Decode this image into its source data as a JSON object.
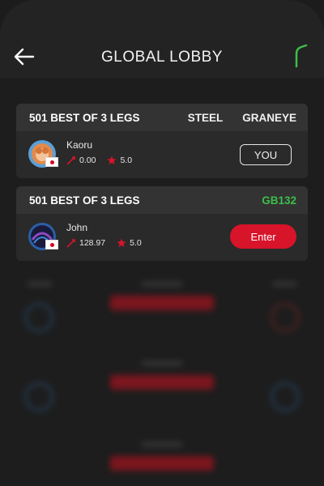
{
  "header": {
    "title": "GLOBAL LOBBY"
  },
  "cards": [
    {
      "title": "501 BEST OF 3 LEGS",
      "tags": [
        "STEEL",
        "GRANEYE"
      ],
      "player": {
        "name": "Kaoru",
        "rating": "0.00",
        "stars": "5.0"
      },
      "action_label": "YOU"
    },
    {
      "title": "501 BEST OF 3 LEGS",
      "code": "GB132",
      "player": {
        "name": "John",
        "rating": "128.97",
        "stars": "5.0"
      },
      "action_label": "Enter"
    }
  ],
  "colors": {
    "accent_green": "#3dbd4a",
    "enter_red": "#d7142a",
    "star_red": "#d7142a",
    "background": "#1d1d1d"
  },
  "icons": {
    "back": "arrow-left-icon",
    "signal": "signal-icon",
    "rating": "dart-icon",
    "star": "star-icon",
    "flag": "japan-flag-icon"
  }
}
